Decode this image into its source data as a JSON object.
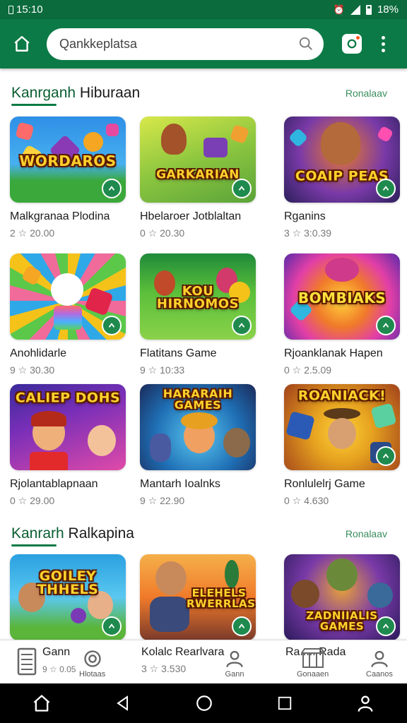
{
  "status": {
    "time": "15:10",
    "battery": "18%"
  },
  "search": {
    "placeholder": "Qankkeplatsa"
  },
  "sections": [
    {
      "title_a": "Kanrganh",
      "title_b": " Hiburaan",
      "link": "Ronalaav"
    },
    {
      "title_a": "Kanrarh",
      "title_b": " Ralkapina",
      "link": "Ronalaav"
    }
  ],
  "games": [
    {
      "title": "Malkgranaa Plodina",
      "meta": "2 ☆ 20.00",
      "thumb_text": "WORDAROS",
      "bg": "#2f8fe6"
    },
    {
      "title": "Hbelaroer Jotblaltan",
      "meta": "0 ☆ 20.30",
      "thumb_text": "GARKARIAN",
      "bg": "#8cc63f"
    },
    {
      "title": "Rganins",
      "meta": "3 ☆ 3:0.39",
      "thumb_text": "COAIP PEAS",
      "bg": "#3a2a6a"
    },
    {
      "title": "Anohlidarle",
      "meta": "9 ☆ 30.30",
      "thumb_text": "",
      "bg": "#f2a12a"
    },
    {
      "title": "Flatitans Game",
      "meta": "9 ☆ 10:33",
      "thumb_text": "KOU HIRNOMOS",
      "bg": "#5bbf3a"
    },
    {
      "title": "Rjoanklanak Hapen",
      "meta": "0 ☆ 2.5.09",
      "thumb_text": "BOMBIAKS",
      "bg": "#e23fa7"
    },
    {
      "title": "Rjolantablapnaan",
      "meta": "0 ☆ 29.00",
      "thumb_text": "CALIEP DOHS",
      "bg": "#7a2fb8"
    },
    {
      "title": "Mantarh Ioalnks",
      "meta": "9 ☆ 22.90",
      "thumb_text": "HARARAIH GAMES",
      "bg": "#1f6fb5"
    },
    {
      "title": "Ronlulelrj Game",
      "meta": "0 ☆ 4.630",
      "thumb_text": "ROANIACK!",
      "bg": "#e6a21f"
    },
    {
      "title": "",
      "meta": "",
      "thumb_text": "GOILEY THHELS",
      "bg": "#2aa0e0"
    },
    {
      "title": "Kolalc Rearlvara",
      "meta": "3 ☆ 3.530",
      "thumb_text": "ELEHELS RWERRLAS",
      "bg": "#f07a2a"
    },
    {
      "title": "Ra..... Rada",
      "meta": "",
      "thumb_text": "ZADNIIALIS GAMES",
      "bg": "#5a2a8a"
    }
  ],
  "tabbar": {
    "tab1_label": "Gann",
    "tab1_meta": "9 ☆ 0.05",
    "tab2_label": "Hlotaas",
    "tab3_label": "Gann",
    "tab4_label": "Gonaaen",
    "tab5_label": "Caanos"
  }
}
